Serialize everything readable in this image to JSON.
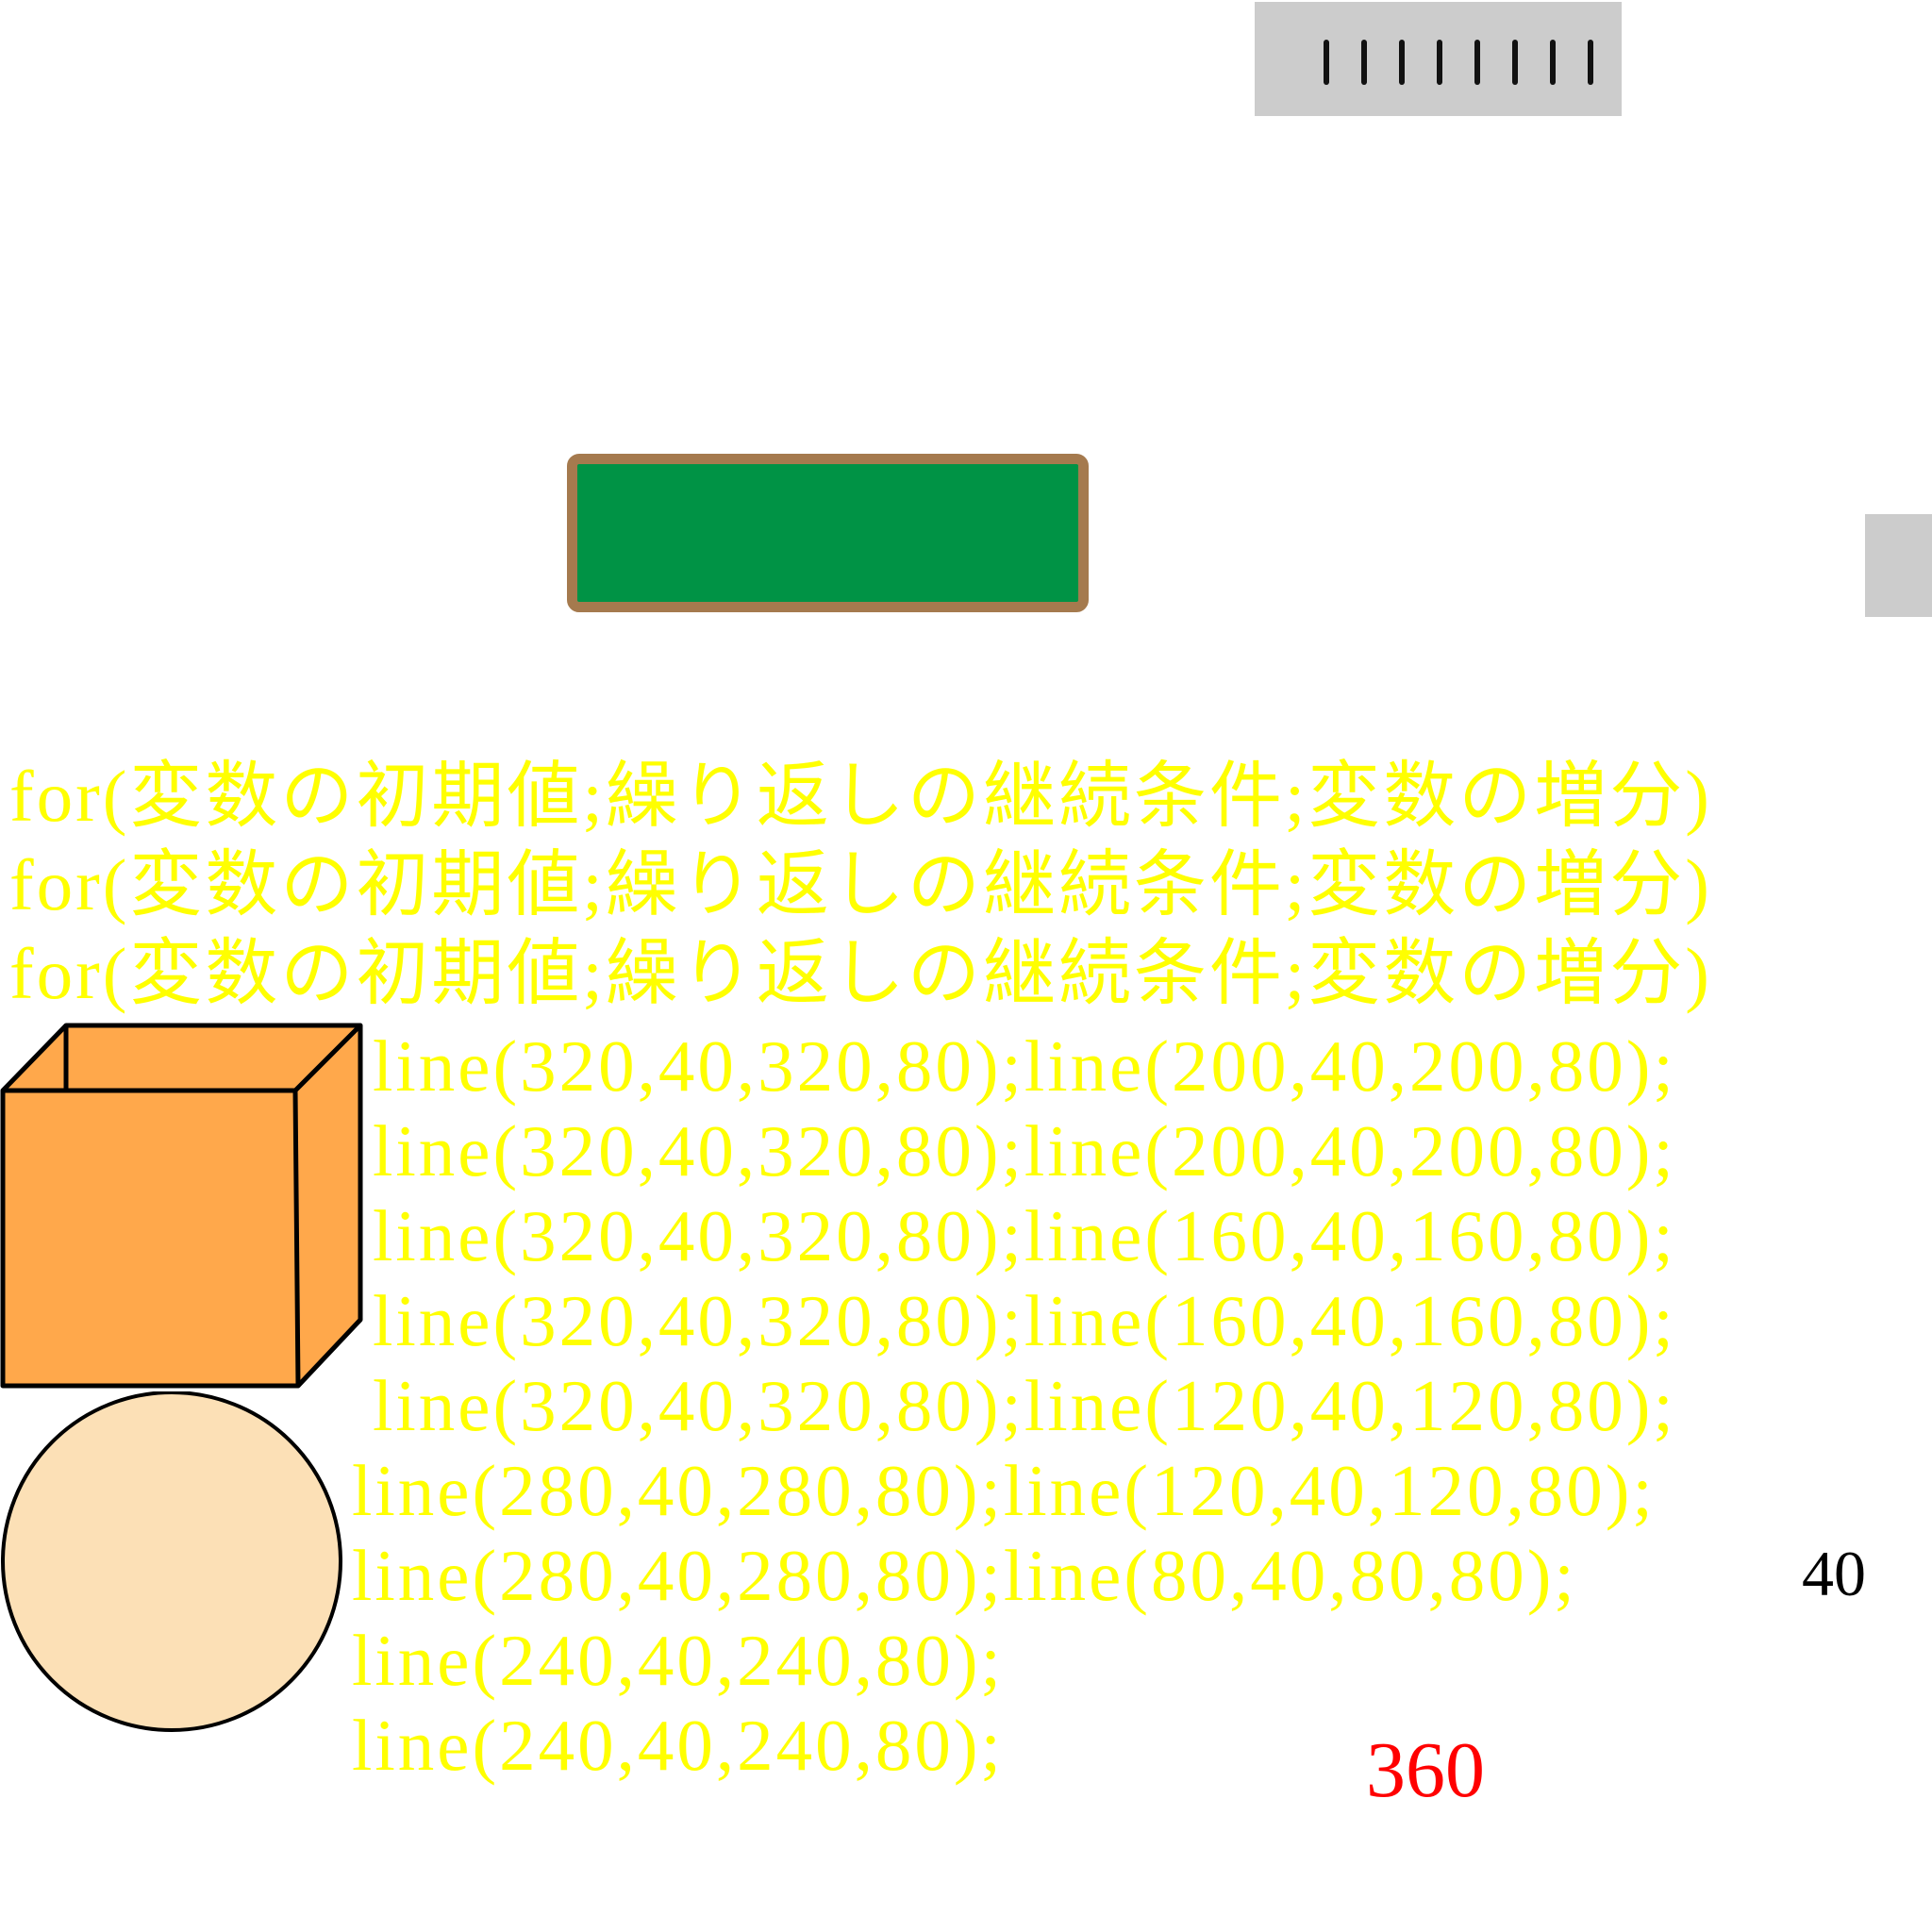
{
  "colors": {
    "code_text": "#ffff00",
    "panel_fill": "#009345",
    "panel_border": "#a57a4e",
    "gray": "#cccccc",
    "cube_fill": "#ffa84b",
    "circle_fill": "#fce0b6",
    "red_number": "#ff0000",
    "black_number": "#000000"
  },
  "tick_count": 8,
  "loop_lines": [
    "for(変数の初期値;繰り返しの継続条件;変数の増分)",
    "for(変数の初期値;繰り返しの継続条件;変数の増分)",
    "for(変数の初期値;繰り返しの継続条件;変数の増分)"
  ],
  "code_lines": [
    "line(320,40,320,80);line(200,40,200,80);",
    "line(320,40,320,80);line(200,40,200,80);",
    "line(320,40,320,80);line(160,40,160,80);",
    "line(320,40,320,80);line(160,40,160,80);",
    "line(320,40,320,80);line(120,40,120,80);",
    "line(280,40,280,80);line(120,40,120,80);",
    "line(280,40,280,80);line(80,40,80,80);",
    "line(240,40,240,80);",
    "line(240,40,240,80);"
  ],
  "numbers": {
    "black": "40",
    "red": "360"
  }
}
